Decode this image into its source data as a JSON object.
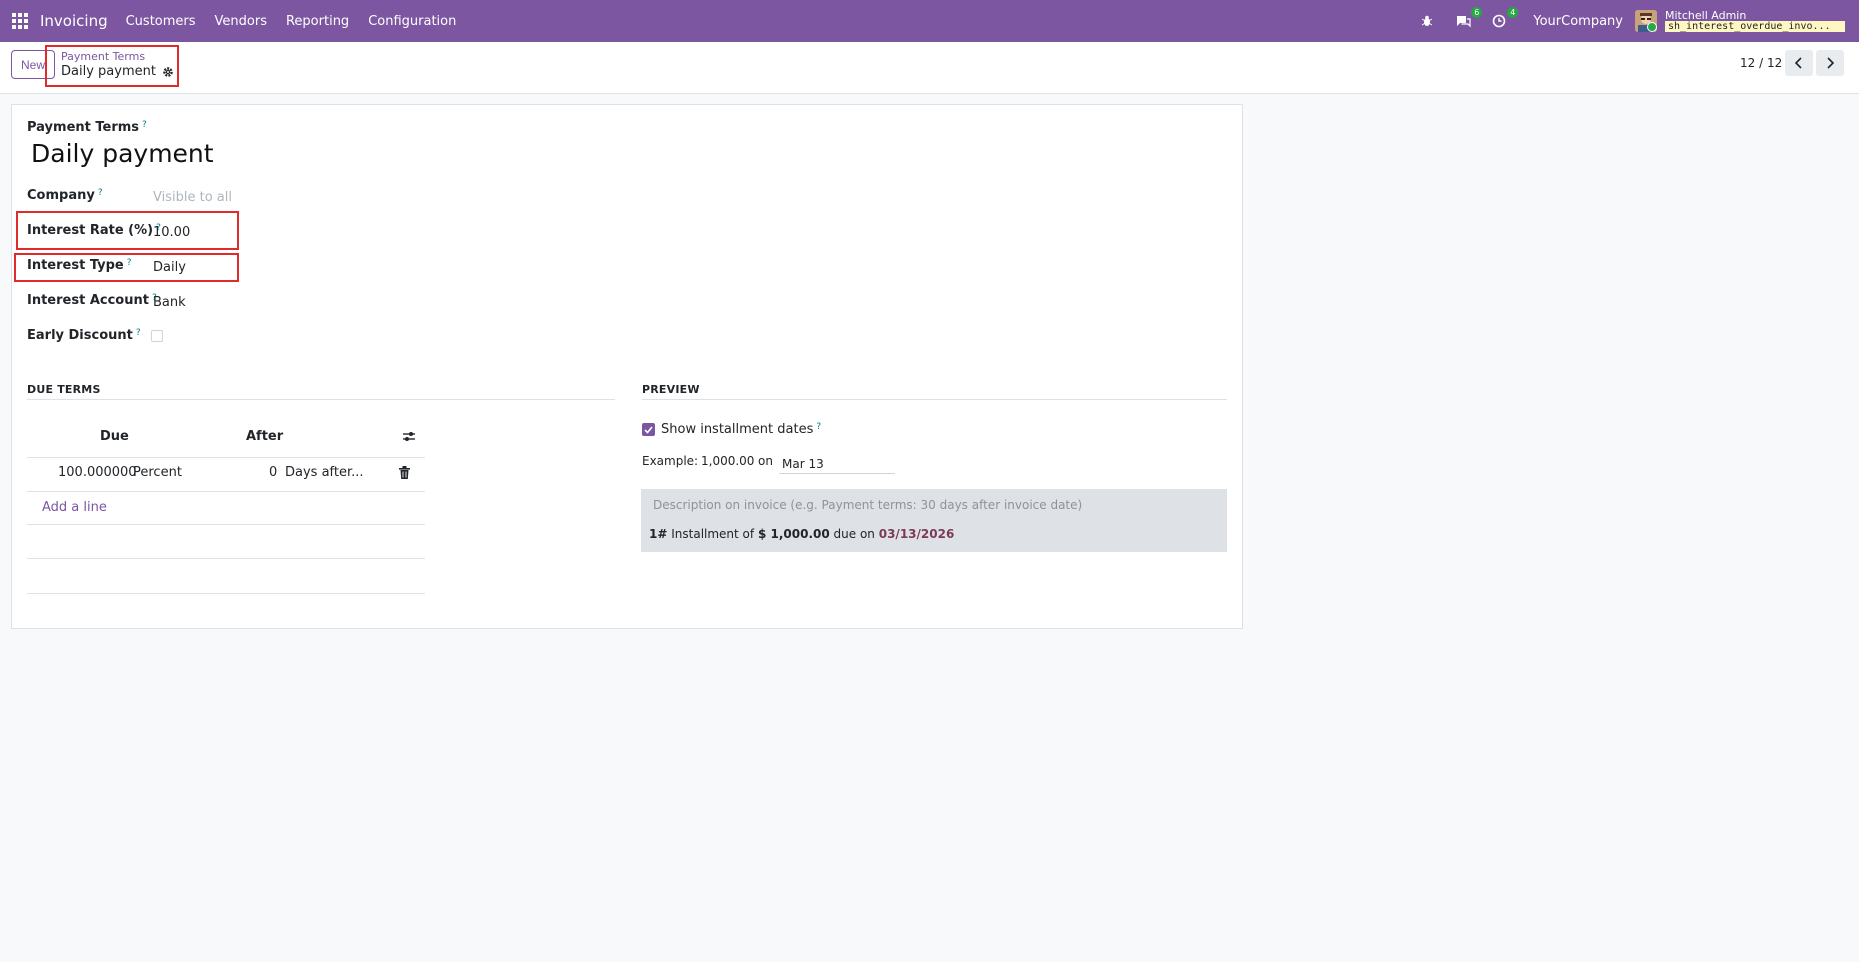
{
  "navbar": {
    "app_name": "Invoicing",
    "menu": [
      "Customers",
      "Vendors",
      "Reporting",
      "Configuration"
    ],
    "messages_count": "6",
    "activities_count": "4",
    "company": "YourCompany",
    "user_name": "Mitchell Admin",
    "database": "sh_interest_overdue_invo..."
  },
  "control_panel": {
    "new_label": "New",
    "breadcrumb_parent": "Payment Terms",
    "breadcrumb_current": "Daily payment",
    "pager": "12 / 12"
  },
  "form": {
    "payment_terms_label": "Payment Terms",
    "name": "Daily payment",
    "company_label": "Company",
    "company_placeholder": "Visible to all",
    "interest_rate_label": "Interest Rate (%)",
    "interest_rate": "10.00",
    "interest_type_label": "Interest Type",
    "interest_type": "Daily",
    "interest_account_label": "Interest Account",
    "interest_account": "Bank",
    "early_discount_label": "Early Discount",
    "help_mark": "?"
  },
  "due_terms": {
    "title": "DUE TERMS",
    "columns": [
      "Due",
      "After"
    ],
    "rows": [
      {
        "value": "100.000000",
        "type": "Percent",
        "days": "0",
        "delay": "Days after..."
      }
    ],
    "add_line": "Add a line"
  },
  "preview": {
    "title": "PREVIEW",
    "show_dates_label": "Show installment dates",
    "example_label": "Example:",
    "example_amount": "1,000.00",
    "on_label": "on",
    "example_date": "Mar 13",
    "description_placeholder": "Description on invoice (e.g. Payment terms: 30 days after invoice date)",
    "installment_number": "1#",
    "installment_text": "Installment of",
    "installment_amount": "$ 1,000.00",
    "due_on_text": "due on",
    "due_date": "03/13/2026"
  },
  "colors": {
    "brand": "#7c56a0",
    "highlight": "#e02b2b",
    "due_date": "#7c3a5a"
  }
}
